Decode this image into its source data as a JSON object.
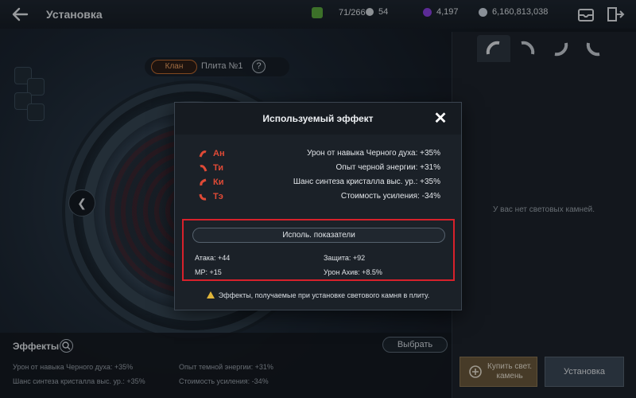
{
  "header": {
    "title": "Установка",
    "resources": [
      {
        "icon": "green-gem-icon",
        "value": "71/266",
        "color": "#5aa83a"
      },
      {
        "icon": "white-orb-icon",
        "value": "54",
        "color": "#d5d9de"
      },
      {
        "icon": "purple-crystal-icon",
        "value": "4,197",
        "color": "#8a3ee0"
      },
      {
        "icon": "silver-coin-icon",
        "value": "6,160,813,038",
        "color": "#cfd8e2"
      }
    ]
  },
  "plate": {
    "clan_label": "Клан",
    "plate_label": "Плита №1",
    "help": "?"
  },
  "right_panel": {
    "empty_text": "У вас нет световых камней."
  },
  "effects": {
    "title": "Эффекты",
    "select_label": "Выбрать",
    "lines": [
      "Урон от навыка Черного духа: +35%",
      "Опыт темной энергии: +31%",
      "Шанс синтеза кристалла выс. ур.: +35%",
      "Стоимость усиления: -34%"
    ]
  },
  "buttons": {
    "buy_line1": "Купить свет.",
    "buy_line2": "камень",
    "install": "Установка"
  },
  "modal": {
    "title": "Используемый эффект",
    "close": "✕",
    "effects": [
      {
        "tag": "Ан",
        "text": "Урон от навыка Черного духа: +35%"
      },
      {
        "tag": "Ти",
        "text": "Опыт черной энергии: +31%"
      },
      {
        "tag": "Ки",
        "text": "Шанс синтеза кристалла выс. ур.: +35%"
      },
      {
        "tag": "Тэ",
        "text": "Стоимость усиления: -34%"
      }
    ],
    "stats_title": "Исполь. показатели",
    "stats": {
      "attack": "Атака: +44",
      "defense": "Защита: +92",
      "mp": "MP: +15",
      "achiv": "Урон Ахив: +8.5%"
    },
    "warning": "Эффекты, получаемые при установке светового камня в плиту."
  },
  "colors": {
    "accent_red": "#e04a36",
    "highlight_box": "#d8212b",
    "clan_orange": "#f2a160"
  }
}
